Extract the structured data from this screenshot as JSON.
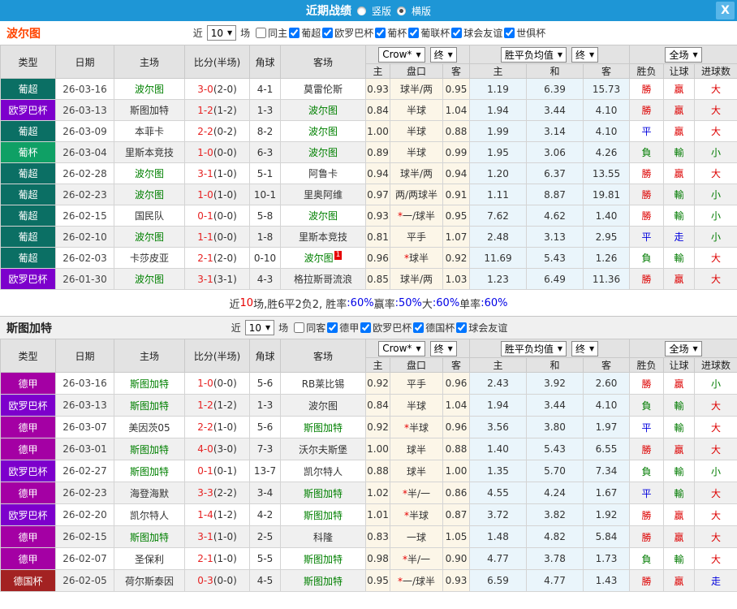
{
  "titlebar": {
    "title": "近期战绩",
    "vertical_label": "竖版",
    "horizontal_label": "横版",
    "close_label": "X"
  },
  "filter_common": {
    "near": "近",
    "count": "10",
    "games": "场"
  },
  "header": {
    "cols": [
      "类型",
      "日期",
      "主场",
      "比分(半场)",
      "角球",
      "客场"
    ],
    "sub": [
      "主",
      "盘口",
      "客",
      "主",
      "和",
      "客",
      "胜负",
      "让球",
      "进球数"
    ],
    "odds_select": "Crow*",
    "final_select": "终",
    "avg_select": "胜平负均值",
    "avg_final_select": "终",
    "scope_select": "全场"
  },
  "type_colors": {
    "葡超": "#0b6f64",
    "葡杯": "#0fa065",
    "欧罗巴杯": "#7d00cc",
    "德甲": "#a400a4",
    "德国杯": "#a32222"
  },
  "result_colors": {
    "勝": "#dd0000",
    "負": "#007b00",
    "平": "#0000dd",
    "贏": "#dd0000",
    "輸": "#007b00",
    "走": "#0000dd",
    "大": "#dd0000",
    "小": "#007b00"
  },
  "team1": {
    "name": "波尔图",
    "same_label": "同主",
    "comps": [
      {
        "label": "葡超",
        "checked": true
      },
      {
        "label": "欧罗巴杯",
        "checked": true
      },
      {
        "label": "葡杯",
        "checked": true
      },
      {
        "label": "葡联杯",
        "checked": true
      },
      {
        "label": "球会友谊",
        "checked": true
      },
      {
        "label": "世俱杯",
        "checked": true
      }
    ],
    "summary": [
      [
        "近",
        "dark"
      ],
      [
        "10",
        "red"
      ],
      [
        "场,胜6平2负2, 胜率",
        "dark"
      ],
      [
        ":60%",
        "blue"
      ],
      [
        " 赢率",
        "dark"
      ],
      [
        ":50%",
        "blue"
      ],
      [
        " 大",
        "dark"
      ],
      [
        ":60%",
        "blue"
      ],
      [
        " 单率",
        "dark"
      ],
      [
        ":60%",
        "blue"
      ]
    ],
    "rows": [
      {
        "t": "葡超",
        "d": "26-03-16",
        "h": "波尔图",
        "hg": true,
        "s": "3-0",
        "hf": "(2-0)",
        "c": "4-1",
        "a": "莫雷伦斯",
        "ag": false,
        "o1": "0.93",
        "pk": "球半/两",
        "star": false,
        "o2": "0.95",
        "w": "1.19",
        "dr": "6.39",
        "l": "15.73",
        "r1": "勝",
        "r2": "贏",
        "r3": "大"
      },
      {
        "t": "欧罗巴杯",
        "d": "26-03-13",
        "h": "斯图加特",
        "hg": false,
        "s": "1-2",
        "hf": "(1-2)",
        "c": "1-3",
        "a": "波尔图",
        "ag": true,
        "o1": "0.84",
        "pk": "半球",
        "star": false,
        "o2": "1.04",
        "w": "1.94",
        "dr": "3.44",
        "l": "4.10",
        "r1": "勝",
        "r2": "贏",
        "r3": "大"
      },
      {
        "t": "葡超",
        "d": "26-03-09",
        "h": "本菲卡",
        "hg": false,
        "s": "2-2",
        "hf": "(0-2)",
        "c": "8-2",
        "a": "波尔图",
        "ag": true,
        "o1": "1.00",
        "pk": "半球",
        "star": false,
        "o2": "0.88",
        "w": "1.99",
        "dr": "3.14",
        "l": "4.10",
        "r1": "平",
        "r2": "贏",
        "r3": "大"
      },
      {
        "t": "葡杯",
        "d": "26-03-04",
        "h": "里斯本竞技",
        "hg": false,
        "s": "1-0",
        "hf": "(0-0)",
        "c": "6-3",
        "a": "波尔图",
        "ag": true,
        "o1": "0.89",
        "pk": "半球",
        "star": false,
        "o2": "0.99",
        "w": "1.95",
        "dr": "3.06",
        "l": "4.26",
        "r1": "負",
        "r2": "輸",
        "r3": "小"
      },
      {
        "t": "葡超",
        "d": "26-02-28",
        "h": "波尔图",
        "hg": true,
        "s": "3-1",
        "hf": "(1-0)",
        "c": "5-1",
        "a": "阿鲁卡",
        "ag": false,
        "o1": "0.94",
        "pk": "球半/两",
        "star": false,
        "o2": "0.94",
        "w": "1.20",
        "dr": "6.37",
        "l": "13.55",
        "r1": "勝",
        "r2": "贏",
        "r3": "大"
      },
      {
        "t": "葡超",
        "d": "26-02-23",
        "h": "波尔图",
        "hg": true,
        "s": "1-0",
        "hf": "(1-0)",
        "c": "10-1",
        "a": "里奥阿维",
        "ag": false,
        "o1": "0.97",
        "pk": "两/两球半",
        "star": false,
        "o2": "0.91",
        "w": "1.11",
        "dr": "8.87",
        "l": "19.81",
        "r1": "勝",
        "r2": "輸",
        "r3": "小"
      },
      {
        "t": "葡超",
        "d": "26-02-15",
        "h": "国民队",
        "hg": false,
        "s": "0-1",
        "hf": "(0-0)",
        "c": "5-8",
        "a": "波尔图",
        "ag": true,
        "o1": "0.93",
        "pk": "一/球半",
        "star": true,
        "o2": "0.95",
        "w": "7.62",
        "dr": "4.62",
        "l": "1.40",
        "r1": "勝",
        "r2": "輸",
        "r3": "小"
      },
      {
        "t": "葡超",
        "d": "26-02-10",
        "h": "波尔图",
        "hg": true,
        "s": "1-1",
        "hf": "(0-0)",
        "c": "1-8",
        "a": "里斯本竞技",
        "ag": false,
        "o1": "0.81",
        "pk": "平手",
        "star": false,
        "o2": "1.07",
        "w": "2.48",
        "dr": "3.13",
        "l": "2.95",
        "r1": "平",
        "r2": "走",
        "r3": "小"
      },
      {
        "t": "葡超",
        "d": "26-02-03",
        "h": "卡莎皮亚",
        "hg": false,
        "s": "2-1",
        "hf": "(2-0)",
        "c": "0-10",
        "a": "波尔图",
        "ag": true,
        "sup": "1",
        "o1": "0.96",
        "pk": "球半",
        "star": true,
        "o2": "0.92",
        "w": "11.69",
        "dr": "5.43",
        "l": "1.26",
        "r1": "負",
        "r2": "輸",
        "r3": "大"
      },
      {
        "t": "欧罗巴杯",
        "d": "26-01-30",
        "h": "波尔图",
        "hg": true,
        "s": "3-1",
        "hf": "(3-1)",
        "c": "4-3",
        "a": "格拉斯哥流浪",
        "ag": false,
        "o1": "0.85",
        "pk": "球半/两",
        "star": false,
        "o2": "1.03",
        "w": "1.23",
        "dr": "6.49",
        "l": "11.36",
        "r1": "勝",
        "r2": "贏",
        "r3": "大"
      }
    ]
  },
  "team2": {
    "name": "斯图加特",
    "same_label": "同客",
    "comps": [
      {
        "label": "德甲",
        "checked": true
      },
      {
        "label": "欧罗巴杯",
        "checked": true
      },
      {
        "label": "德国杯",
        "checked": true
      },
      {
        "label": "球会友谊",
        "checked": true
      }
    ],
    "rows": [
      {
        "t": "德甲",
        "d": "26-03-16",
        "h": "斯图加特",
        "hg": true,
        "s": "1-0",
        "hf": "(0-0)",
        "c": "5-6",
        "a": "RB莱比锡",
        "ag": false,
        "o1": "0.92",
        "pk": "平手",
        "star": false,
        "o2": "0.96",
        "w": "2.43",
        "dr": "3.92",
        "l": "2.60",
        "r1": "勝",
        "r2": "贏",
        "r3": "小"
      },
      {
        "t": "欧罗巴杯",
        "d": "26-03-13",
        "h": "斯图加特",
        "hg": true,
        "s": "1-2",
        "hf": "(1-2)",
        "c": "1-3",
        "a": "波尔图",
        "ag": false,
        "o1": "0.84",
        "pk": "半球",
        "star": false,
        "o2": "1.04",
        "w": "1.94",
        "dr": "3.44",
        "l": "4.10",
        "r1": "負",
        "r2": "輸",
        "r3": "大"
      },
      {
        "t": "德甲",
        "d": "26-03-07",
        "h": "美因茨05",
        "hg": false,
        "s": "2-2",
        "hf": "(1-0)",
        "c": "5-6",
        "a": "斯图加特",
        "ag": true,
        "o1": "0.92",
        "pk": "半球",
        "star": true,
        "o2": "0.96",
        "w": "3.56",
        "dr": "3.80",
        "l": "1.97",
        "r1": "平",
        "r2": "輸",
        "r3": "大"
      },
      {
        "t": "德甲",
        "d": "26-03-01",
        "h": "斯图加特",
        "hg": true,
        "s": "4-0",
        "hf": "(3-0)",
        "c": "7-3",
        "a": "沃尔夫斯堡",
        "ag": false,
        "o1": "1.00",
        "pk": "球半",
        "star": false,
        "o2": "0.88",
        "w": "1.40",
        "dr": "5.43",
        "l": "6.55",
        "r1": "勝",
        "r2": "贏",
        "r3": "大"
      },
      {
        "t": "欧罗巴杯",
        "d": "26-02-27",
        "h": "斯图加特",
        "hg": true,
        "s": "0-1",
        "hf": "(0-1)",
        "c": "13-7",
        "a": "凯尔特人",
        "ag": false,
        "o1": "0.88",
        "pk": "球半",
        "star": false,
        "o2": "1.00",
        "w": "1.35",
        "dr": "5.70",
        "l": "7.34",
        "r1": "負",
        "r2": "輸",
        "r3": "小"
      },
      {
        "t": "德甲",
        "d": "26-02-23",
        "h": "海登海默",
        "hg": false,
        "s": "3-3",
        "hf": "(2-2)",
        "c": "3-4",
        "a": "斯图加特",
        "ag": true,
        "o1": "1.02",
        "pk": "半/一",
        "star": true,
        "o2": "0.86",
        "w": "4.55",
        "dr": "4.24",
        "l": "1.67",
        "r1": "平",
        "r2": "輸",
        "r3": "大"
      },
      {
        "t": "欧罗巴杯",
        "d": "26-02-20",
        "h": "凯尔特人",
        "hg": false,
        "s": "1-4",
        "hf": "(1-2)",
        "c": "4-2",
        "a": "斯图加特",
        "ag": true,
        "o1": "1.01",
        "pk": "半球",
        "star": true,
        "o2": "0.87",
        "w": "3.72",
        "dr": "3.82",
        "l": "1.92",
        "r1": "勝",
        "r2": "贏",
        "r3": "大"
      },
      {
        "t": "德甲",
        "d": "26-02-15",
        "h": "斯图加特",
        "hg": true,
        "s": "3-1",
        "hf": "(1-0)",
        "c": "2-5",
        "a": "科隆",
        "ag": false,
        "o1": "0.83",
        "pk": "一球",
        "star": false,
        "o2": "1.05",
        "w": "1.48",
        "dr": "4.82",
        "l": "5.84",
        "r1": "勝",
        "r2": "贏",
        "r3": "大"
      },
      {
        "t": "德甲",
        "d": "26-02-07",
        "h": "圣保利",
        "hg": false,
        "s": "2-1",
        "hf": "(1-0)",
        "c": "5-5",
        "a": "斯图加特",
        "ag": true,
        "o1": "0.98",
        "pk": "半/一",
        "star": true,
        "o2": "0.90",
        "w": "4.77",
        "dr": "3.78",
        "l": "1.73",
        "r1": "負",
        "r2": "輸",
        "r3": "大"
      },
      {
        "t": "德国杯",
        "d": "26-02-05",
        "h": "荷尔斯泰因",
        "hg": false,
        "s": "0-3",
        "hf": "(0-0)",
        "c": "4-5",
        "a": "斯图加特",
        "ag": true,
        "o1": "0.95",
        "pk": "一/球半",
        "star": true,
        "o2": "0.93",
        "w": "6.59",
        "dr": "4.77",
        "l": "1.43",
        "r1": "勝",
        "r2": "贏",
        "r3": "走"
      }
    ]
  }
}
